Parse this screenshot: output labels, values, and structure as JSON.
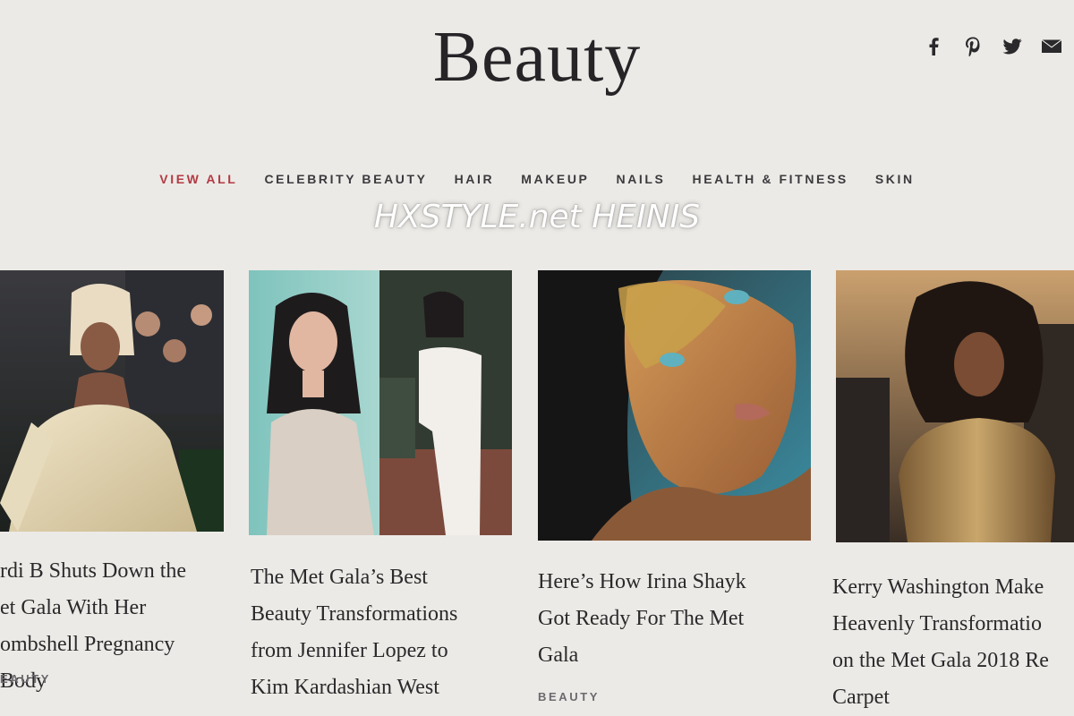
{
  "page": {
    "title": "Beauty"
  },
  "social": [
    {
      "name": "facebook-icon"
    },
    {
      "name": "pinterest-icon"
    },
    {
      "name": "twitter-icon"
    },
    {
      "name": "email-icon"
    }
  ],
  "nav": {
    "items": [
      {
        "label": "VIEW ALL",
        "active": true
      },
      {
        "label": "CELEBRITY BEAUTY",
        "active": false
      },
      {
        "label": "HAIR",
        "active": false
      },
      {
        "label": "MAKEUP",
        "active": false
      },
      {
        "label": "NAILS",
        "active": false
      },
      {
        "label": "HEALTH & FITNESS",
        "active": false
      },
      {
        "label": "SKIN",
        "active": false
      }
    ]
  },
  "watermark": "HXSTYLE.net HEINIS",
  "articles": [
    {
      "headline": "rdi B Shuts Down the\net Gala With Her\nombshell Pregnancy Body",
      "category": "EAUTY"
    },
    {
      "headline": "The Met Gala’s Best\nBeauty Transformations\nfrom Jennifer Lopez to\nKim Kardashian West",
      "category": ""
    },
    {
      "headline": "Here’s How Irina Shayk\nGot Ready For The Met\nGala",
      "category": "BEAUTY"
    },
    {
      "headline": "Kerry Washington Make\nHeavenly Transformatio\non the Met Gala 2018 Re\nCarpet",
      "category": ""
    }
  ],
  "colors": {
    "accent": "#b33a44",
    "background": "#eceae6",
    "text": "#2b2a2c"
  }
}
